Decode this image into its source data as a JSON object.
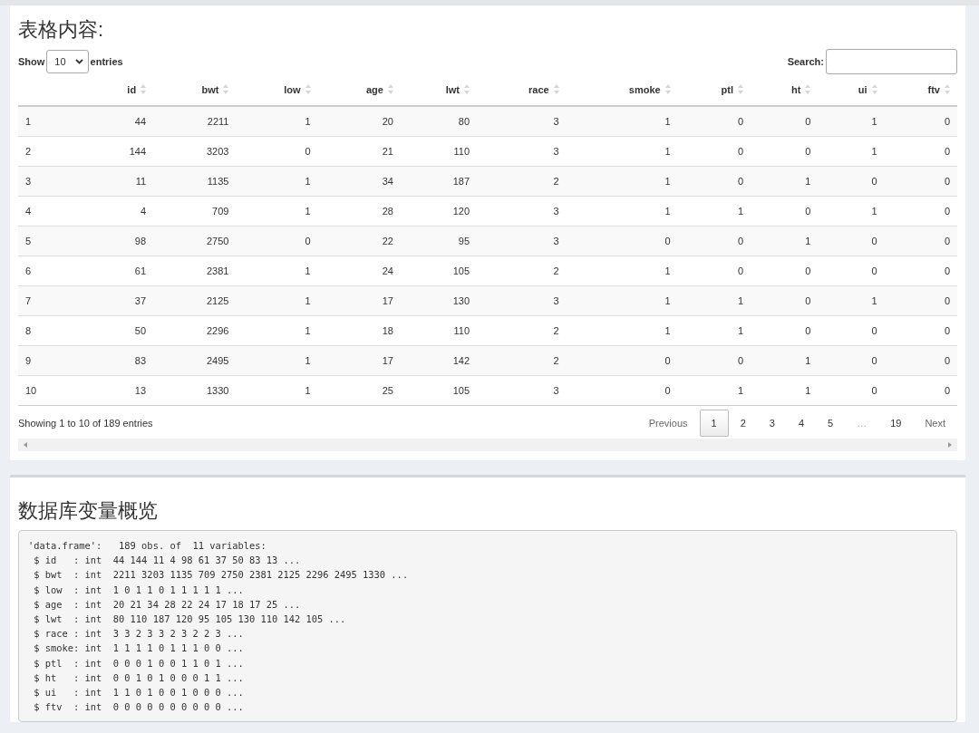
{
  "table_section": {
    "title": "表格内容:",
    "length": {
      "before": "Show",
      "value": "10",
      "after": "entries"
    },
    "search": {
      "label": "Search:"
    },
    "columns": [
      "",
      "id",
      "bwt",
      "low",
      "age",
      "lwt",
      "race",
      "smoke",
      "ptl",
      "ht",
      "ui",
      "ftv"
    ],
    "rows": [
      [
        "1",
        "44",
        "2211",
        "1",
        "20",
        "80",
        "3",
        "1",
        "0",
        "0",
        "1",
        "0"
      ],
      [
        "2",
        "144",
        "3203",
        "0",
        "21",
        "110",
        "3",
        "1",
        "0",
        "0",
        "1",
        "0"
      ],
      [
        "3",
        "11",
        "1135",
        "1",
        "34",
        "187",
        "2",
        "1",
        "0",
        "1",
        "0",
        "0"
      ],
      [
        "4",
        "4",
        "709",
        "1",
        "28",
        "120",
        "3",
        "1",
        "1",
        "0",
        "1",
        "0"
      ],
      [
        "5",
        "98",
        "2750",
        "0",
        "22",
        "95",
        "3",
        "0",
        "0",
        "1",
        "0",
        "0"
      ],
      [
        "6",
        "61",
        "2381",
        "1",
        "24",
        "105",
        "2",
        "1",
        "0",
        "0",
        "0",
        "0"
      ],
      [
        "7",
        "37",
        "2125",
        "1",
        "17",
        "130",
        "3",
        "1",
        "1",
        "0",
        "1",
        "0"
      ],
      [
        "8",
        "50",
        "2296",
        "1",
        "18",
        "110",
        "2",
        "1",
        "1",
        "0",
        "0",
        "0"
      ],
      [
        "9",
        "83",
        "2495",
        "1",
        "17",
        "142",
        "2",
        "0",
        "0",
        "1",
        "0",
        "0"
      ],
      [
        "10",
        "13",
        "1330",
        "1",
        "25",
        "105",
        "3",
        "0",
        "1",
        "1",
        "0",
        "0"
      ]
    ],
    "info": "Showing 1 to 10 of 189 entries",
    "pagination": [
      {
        "label": "Previous",
        "kind": "nav",
        "selected": false
      },
      {
        "label": "1",
        "kind": "page",
        "selected": true
      },
      {
        "label": "2",
        "kind": "page",
        "selected": false
      },
      {
        "label": "3",
        "kind": "page",
        "selected": false
      },
      {
        "label": "4",
        "kind": "page",
        "selected": false
      },
      {
        "label": "5",
        "kind": "page",
        "selected": false
      },
      {
        "label": "…",
        "kind": "ellipsis",
        "selected": false
      },
      {
        "label": "19",
        "kind": "page",
        "selected": false
      },
      {
        "label": "Next",
        "kind": "nav",
        "selected": false
      }
    ]
  },
  "summary_section": {
    "title": "数据库变量概览",
    "output_lines": [
      "'data.frame':\t189 obs. of  11 variables:",
      " $ id   : int  44 144 11 4 98 61 37 50 83 13 ...",
      " $ bwt  : int  2211 3203 1135 709 2750 2381 2125 2296 2495 1330 ...",
      " $ low  : int  1 0 1 1 0 1 1 1 1 1 ...",
      " $ age  : int  20 21 34 28 22 24 17 18 17 25 ...",
      " $ lwt  : int  80 110 187 120 95 105 130 110 142 105 ...",
      " $ race : int  3 3 2 3 3 2 3 2 2 3 ...",
      " $ smoke: int  1 1 1 1 0 1 1 1 0 0 ...",
      " $ ptl  : int  0 0 0 1 0 0 1 1 0 1 ...",
      " $ ht   : int  0 0 1 0 1 0 0 0 1 1 ...",
      " $ ui   : int  1 1 0 1 0 0 1 0 0 0 ...",
      " $ ftv  : int  0 0 0 0 0 0 0 0 0 0 ..."
    ]
  }
}
